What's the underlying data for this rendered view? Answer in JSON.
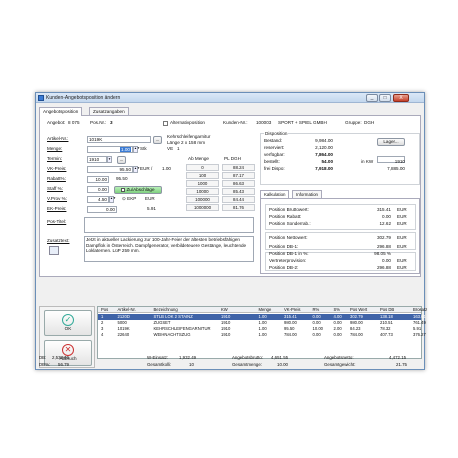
{
  "window": {
    "title": "Kunden-Angebotsposition ändern",
    "buttons": [
      "_",
      "□",
      "X"
    ]
  },
  "tabs": [
    "Angebotsposition",
    "Zusatzangaben"
  ],
  "header": {
    "angebot_label": "Angebot:",
    "angebot": "8 075",
    "pos_label": "Pos.Nr.:",
    "pos": "3",
    "alternativ_label": "Alternativposition",
    "kunden_label": "Kunden-Nr.:",
    "kunden": "100003",
    "kunde": "SPORT + SPIEL GMBH",
    "gruppe_label": "Gruppe:",
    "gruppe": "DGH"
  },
  "form": {
    "artikel_label": "Artikel-Nr.:",
    "artikel": "1019K",
    "ellipsis": "...",
    "menge_label": "Menge:",
    "menge": "1.00",
    "menge_unit": "Stk",
    "termin_label": "Termin:",
    "termin": "1910",
    "vk_label": "VK-Preis:",
    "vk": "95.50",
    "vk_unit": "EUR /",
    "vk_per": "1.00",
    "rabatt_label": "Rabatt%:",
    "rabatt": "10.00",
    "rabatt_val": "95.50",
    "staffel_label": "Staff %:",
    "staffel": "0.00",
    "zuab_label": "Zu/Abschläge",
    "vprov_label": "V.Prov %:",
    "vprov": "4.50",
    "ekp_label": "EKP",
    "ek_label": "EK-Preis:",
    "ek": "0.00",
    "ek_cur": "EUR",
    "ek_val": "5.91",
    "postitel_label": "Pos-Titel:",
    "zusatz_label": "Zusatztext:",
    "zusatz": "Jetzt in aktueller Lackierung zur 100-Jahr-Feier der ältesten betriebsfähigen Dampflok in Österreich. Dampfgenerator, verbildeteuere Gestänge, leuchtende Loklaternen. LüP 259 mm."
  },
  "article": {
    "line1": "Kehrschleifengarnitur",
    "line2": "Länge 2 x 158 mm",
    "ve_label": "VE",
    "ve": "1"
  },
  "staffel_table": {
    "headers": [
      "Ab Menge",
      "PL DGH"
    ],
    "rows": [
      [
        "0",
        "88.24"
      ],
      [
        "100",
        "87.17"
      ],
      [
        "1000",
        "86.63"
      ],
      [
        "10000",
        "85.43"
      ],
      [
        "100000",
        "84.44"
      ],
      [
        "1000000",
        "81.76"
      ]
    ]
  },
  "disposition": {
    "title": "Disposition",
    "lager_label": "Lager...",
    "rows": [
      {
        "label": "Bestand:",
        "value": "9,984.00"
      },
      {
        "label": "reserviert:",
        "value": "2,120.00"
      },
      {
        "label": "verfügbar:",
        "value": "7,864.00"
      },
      {
        "label": "bestellt:",
        "value": "54.00",
        "extra_label": "in KW",
        "extra": "1910"
      },
      {
        "label": "frei Dispo:",
        "value": "7,918.00",
        "extra": "7,885.00"
      }
    ]
  },
  "kalk_tabs": [
    "Kalkulation",
    "Information"
  ],
  "kalkulation": [
    {
      "label": "Position Bruttowert:",
      "value": "315.41",
      "unit": "EUR"
    },
    {
      "label": "Position Rabatt:",
      "value": "0.00",
      "unit": "EUR"
    },
    {
      "label": "Position Sonderrab.:",
      "value": "12.62",
      "unit": "EUR"
    },
    {
      "label": "Position Nettowert:",
      "value": "302.79",
      "unit": "EUR"
    },
    {
      "label": "Position DB-1:",
      "value": "296.88",
      "unit": "EUR"
    },
    {
      "label": "Position DB-1 in %:",
      "value": "98.05 %",
      "unit": ""
    },
    {
      "label": "Vertreterprovision:",
      "value": "0.00",
      "unit": "EUR"
    },
    {
      "label": "Position DB-2:",
      "value": "296.88",
      "unit": "EUR"
    }
  ],
  "side": {
    "ok_label": "OK",
    "abbruch_label": "Abbruch"
  },
  "grid": {
    "headers": [
      "Pos",
      "Artikel-Nr.",
      "Bezeichnung",
      "KW",
      "Menge",
      "VK-Preis",
      "R%",
      "S%",
      "Pos Wert",
      "Pos DB",
      "Brosatz"
    ],
    "rows": [
      [
        "1",
        "2120D",
        "STLB LOK 2 STAINZ",
        "1910",
        "1.00",
        "315.41",
        "0.00",
        "4.00",
        "302.79",
        "138.18",
        "163.61"
      ],
      [
        "2",
        "5000",
        "ZUGSET",
        "1910",
        "1.00",
        "980.00",
        "0.00",
        "0.00",
        "980.00",
        "210.51",
        "761.49"
      ],
      [
        "3",
        "1019K",
        "KEHRSCHLEIFENGARNITUR",
        "1910",
        "1.00",
        "95.50",
        "10.00",
        "2.00",
        "84.23",
        "78.32",
        "5.91"
      ],
      [
        "4",
        "22640",
        "WEIHNACHTSZUG",
        "1910",
        "1.00",
        "784.00",
        "0.00",
        "0.00",
        "784.00",
        "407.73",
        "376.27"
      ]
    ]
  },
  "summary": {
    "db_label": "DB:",
    "db": "2,538.66",
    "db_pct_label": "DB%:",
    "db_pct": "56.79",
    "wertsatz_label": "W-Einsatz:",
    "wertsatz": "1,932.49",
    "gesamtkolli_label": "Gesamtkolli:",
    "gesamtkolli": "10",
    "brutto_label": "Angebotsbrutto:",
    "brutto": "4,651.55",
    "gesamtmenge_label": "Gesamtmenge:",
    "gesamtmenge": "10.00",
    "netto_label": "Angebotsnetto:",
    "netto": "4,472.15",
    "gewicht_label": "Gesamtgewicht:",
    "gewicht": "21.75"
  },
  "colors": {
    "accent": "#3a7bd5",
    "selected_row": "#3f63a8",
    "title_bar": "#c3d7ee",
    "green_button": "#8fd88f"
  }
}
